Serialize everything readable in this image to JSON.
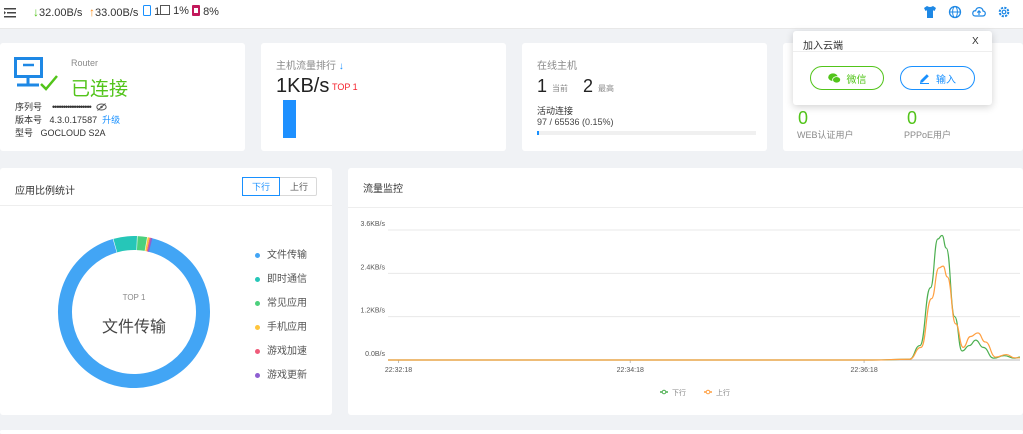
{
  "topbar": {
    "download_speed": "32.00B/s",
    "upload_speed": "33.00B/s",
    "devices": "1",
    "cpu": "1%",
    "memory": "8%",
    "icons": [
      "menu-icon",
      "shirt-icon",
      "globe-icon",
      "cloud-upload-icon",
      "gear-icon"
    ]
  },
  "router_card": {
    "kind": "Router",
    "status": "已连接",
    "serial_label": "序列号",
    "serial_value": "••••••••••••••••••",
    "version_label": "版本号",
    "version_value": "4.3.0.17587",
    "upgrade_link": "升级",
    "model_label": "型号",
    "model_value": "GOCLOUD S2A",
    "status_color": "#52c41a"
  },
  "traffic_rank_card": {
    "title": "主机流量排行",
    "value": "1KB/s",
    "badge": "TOP 1",
    "bar_fill": 1.0
  },
  "online_card": {
    "title": "在线主机",
    "current_value": "1",
    "current_label": "当前",
    "max_value": "2",
    "max_label": "最高",
    "active_label": "活动连接",
    "active_value": "97 / 65536 (0.15%)",
    "active_fraction": 0.0015
  },
  "users_card": {
    "web_value": "0",
    "web_label": "WEB认证用户",
    "pppoe_value": "0",
    "pppoe_label": "PPPoE用户"
  },
  "cloud_popup": {
    "title": "加入云端",
    "close": "X",
    "wechat_button": "微信",
    "input_button": "输入"
  },
  "app_stats": {
    "title": "应用比例统计",
    "tab_down": "下行",
    "tab_up": "上行",
    "center_top": "TOP 1",
    "center_label": "文件传输",
    "legend": [
      {
        "label": "文件传输",
        "color": "#42a5f5"
      },
      {
        "label": "即时通信",
        "color": "#26c6b8"
      },
      {
        "label": "常见应用",
        "color": "#4cd07d"
      },
      {
        "label": "手机应用",
        "color": "#ffc53d"
      },
      {
        "label": "游戏加速",
        "color": "#ef5b7a"
      },
      {
        "label": "游戏更新",
        "color": "#8e5fd1"
      }
    ],
    "slices": [
      {
        "name": "文件传输",
        "value": 92
      },
      {
        "name": "即时通信",
        "value": 5
      },
      {
        "name": "常见应用",
        "value": 2
      },
      {
        "name": "手机应用",
        "value": 0.4
      },
      {
        "name": "游戏加速",
        "value": 0.3
      },
      {
        "name": "游戏更新",
        "value": 0.3
      }
    ]
  },
  "traffic_monitor": {
    "title": "流量监控"
  },
  "chart_data": {
    "type": "line",
    "yticks": [
      "0.0B/s",
      "1.2KB/s",
      "2.4KB/s",
      "3.6KB/s"
    ],
    "ylim": [
      0,
      3.6
    ],
    "xticks": [
      "22:32:18",
      "22:34:18",
      "22:36:18"
    ],
    "xlim": [
      0,
      6
    ],
    "grid": true,
    "legend_position": "bottom",
    "series": [
      {
        "name": "下行",
        "color": "#4caf50",
        "points": [
          [
            0,
            0
          ],
          [
            4.6,
            0
          ],
          [
            4.95,
            0.02
          ],
          [
            5.05,
            0.4
          ],
          [
            5.15,
            2.0
          ],
          [
            5.22,
            3.35
          ],
          [
            5.26,
            3.45
          ],
          [
            5.3,
            3.1
          ],
          [
            5.38,
            1.2
          ],
          [
            5.45,
            0.25
          ],
          [
            5.52,
            0.4
          ],
          [
            5.58,
            0.55
          ],
          [
            5.65,
            0.35
          ],
          [
            5.75,
            0.05
          ],
          [
            5.85,
            0.12
          ],
          [
            5.95,
            0.05
          ],
          [
            6,
            0.08
          ]
        ]
      },
      {
        "name": "上行",
        "color": "#ff9f40",
        "points": [
          [
            0,
            0
          ],
          [
            4.6,
            0
          ],
          [
            4.95,
            0.02
          ],
          [
            5.06,
            0.35
          ],
          [
            5.16,
            1.7
          ],
          [
            5.23,
            2.55
          ],
          [
            5.27,
            2.6
          ],
          [
            5.31,
            2.3
          ],
          [
            5.39,
            1.0
          ],
          [
            5.46,
            0.35
          ],
          [
            5.53,
            0.65
          ],
          [
            5.6,
            0.75
          ],
          [
            5.67,
            0.5
          ],
          [
            5.77,
            0.08
          ],
          [
            5.87,
            0.15
          ],
          [
            5.95,
            0.06
          ],
          [
            6,
            0.06
          ]
        ]
      }
    ]
  }
}
